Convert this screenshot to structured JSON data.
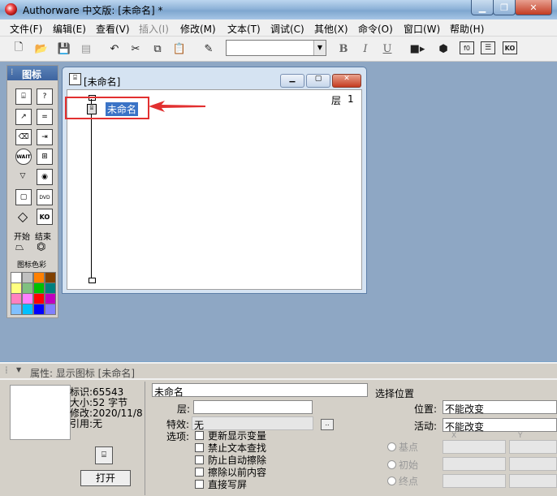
{
  "window": {
    "title": "Authorware 中文版: [未命名] *"
  },
  "menu": [
    "文件(F)",
    "编辑(E)",
    "查看(V)",
    "插入(I)",
    "修改(M)",
    "文本(T)",
    "调试(C)",
    "其他(X)",
    "命令(O)",
    "窗口(W)",
    "帮助(H)"
  ],
  "toolbar": {
    "bold": "B",
    "italic": "I",
    "underline": "U",
    "font_value": ""
  },
  "palette": {
    "title": "图标",
    "start_label": "开始",
    "end_label": "结束",
    "color_label": "图标色彩",
    "wait_label": "WAIT",
    "dvd_label": "DVD",
    "ko_label": "KO",
    "swatches": [
      "#ffffff",
      "#c0c0c0",
      "#ff8000",
      "#804000",
      "#ffff80",
      "#80c080",
      "#00c000",
      "#008080",
      "#ff80c0",
      "#ff80ff",
      "#ff0000",
      "#c000c0",
      "#80c0ff",
      "#00c0ff",
      "#0000ff",
      "#8080ff"
    ]
  },
  "flowline": {
    "window_title": "[未命名]",
    "layer_label": "层",
    "layer_value": "1",
    "icon_label": "未命名"
  },
  "properties": {
    "header": "属性: 显示图标 [未命名]",
    "info_id": "标识:65543",
    "info_size": "大小:52 字节",
    "info_modified": "修改:2020/11/8",
    "info_ref": "引用:无",
    "open_button": "打开",
    "name_value": "未命名",
    "layer_label": "层:",
    "layer_value": "",
    "effect_label": "特效:",
    "effect_value": "无",
    "options_label": "选项:",
    "options": [
      "更新显示变量",
      "禁止文本查找",
      "防止自动擦除",
      "擦除以前内容",
      "直接写屏"
    ],
    "position_mode_label": "选择位置",
    "position_label": "位置:",
    "position_value": "不能改变",
    "activity_label": "活动:",
    "activity_value": "不能改变",
    "base_label": "基点",
    "initial_label": "初始",
    "end_label": "终点",
    "x_label": "X",
    "y_label": "Y"
  }
}
